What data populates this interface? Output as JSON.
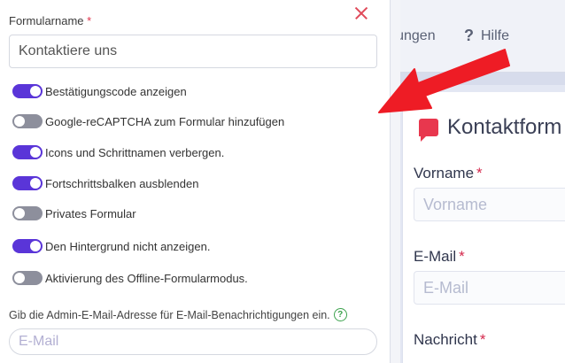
{
  "form_settings": {
    "field_label": "Formularname",
    "required_mark": "*",
    "name_value": "Kontaktiere uns",
    "toggles": [
      {
        "label": "Bestätigungscode anzeigen",
        "on": true
      },
      {
        "label": "Google-reCAPTCHA zum Formular hinzufügen",
        "on": false
      },
      {
        "label": "Icons und Schrittnamen verbergen.",
        "on": true
      },
      {
        "label": "Fortschrittsbalken ausblenden",
        "on": true
      },
      {
        "label": "Privates Formular",
        "on": false
      },
      {
        "label": "Den Hintergrund nicht anzeigen.",
        "on": true
      },
      {
        "label": "Aktivierung des Offline-Formularmodus.",
        "on": false
      }
    ],
    "admin_email_text": "Gib die Admin-E-Mail-Adresse für E-Mail-Benachrichtigungen ein.",
    "help_symbol": "?",
    "email_placeholder": "E-Mail"
  },
  "background_app": {
    "nav_partial": "llungen",
    "help_symbol": "?",
    "help_label": "Hilfe",
    "form_title": "Kontaktform",
    "fields": [
      {
        "label": "Vorname",
        "placeholder": "Vorname"
      },
      {
        "label": "E-Mail",
        "placeholder": "E-Mail"
      },
      {
        "label": "Nachricht"
      }
    ],
    "required_mark": "*"
  },
  "colors": {
    "toggle_on": "#5a35d8",
    "toggle_off": "#8d8f9c",
    "arrow": "#ee1c25",
    "required": "#e0334b",
    "help_icon": "#3ca24d"
  },
  "icons": {
    "close": "close-icon",
    "help": "help-circle-icon",
    "chat": "chat-bubble-icon",
    "arrow": "red-arrow-annotation"
  }
}
